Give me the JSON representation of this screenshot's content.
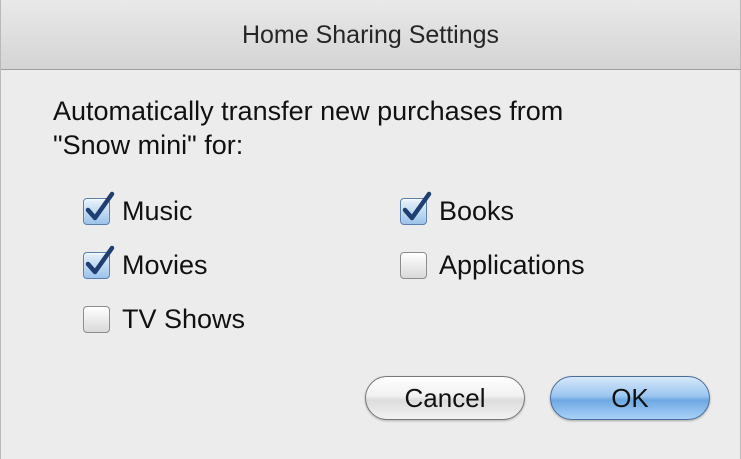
{
  "window": {
    "title": "Home Sharing Settings"
  },
  "prompt": {
    "line1": "Automatically transfer new purchases from",
    "line2": "\"Snow mini\" for:"
  },
  "options": {
    "music": {
      "label": "Music",
      "checked": true
    },
    "books": {
      "label": "Books",
      "checked": true
    },
    "movies": {
      "label": "Movies",
      "checked": true
    },
    "applications": {
      "label": "Applications",
      "checked": false
    },
    "tv_shows": {
      "label": "TV Shows",
      "checked": false
    }
  },
  "buttons": {
    "cancel_label": "Cancel",
    "ok_label": "OK"
  },
  "colors": {
    "check_mark": "#1f3f73",
    "default_button": "#8ebde9"
  }
}
